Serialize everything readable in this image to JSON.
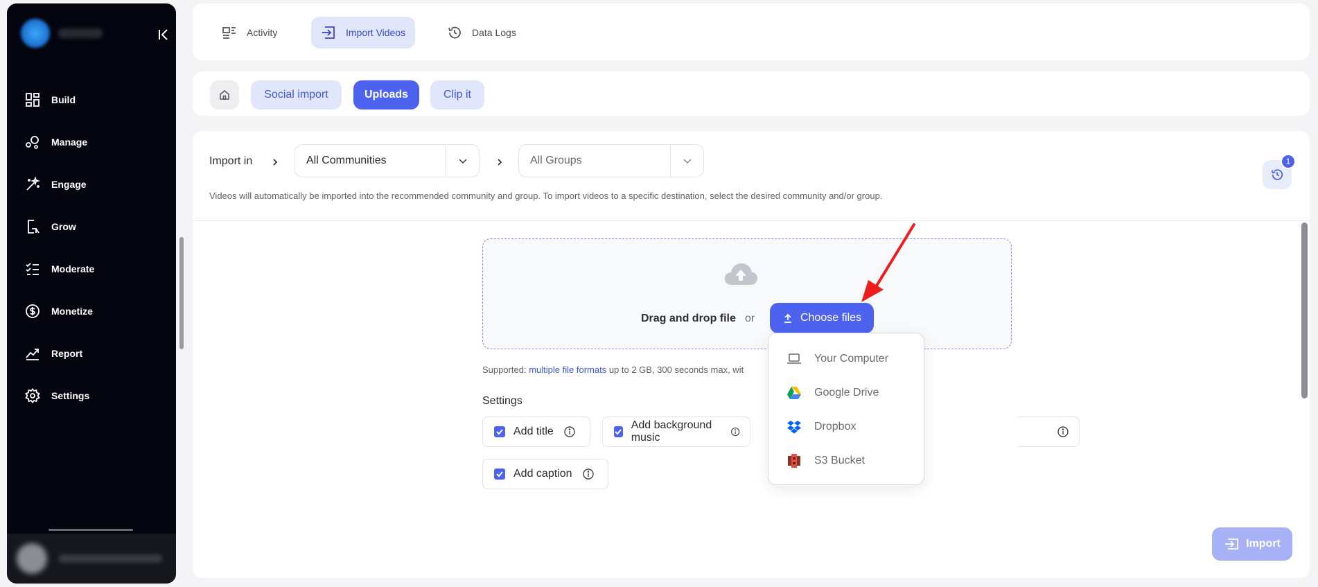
{
  "topTabs": [
    {
      "label": "Activity",
      "icon": "activity-icon",
      "active": false
    },
    {
      "label": "Import Videos",
      "icon": "import-icon",
      "active": true
    },
    {
      "label": "Data Logs",
      "icon": "history-icon",
      "active": false
    }
  ],
  "sidebar": {
    "items": [
      {
        "label": "Build",
        "icon": "grid-icon"
      },
      {
        "label": "Manage",
        "icon": "manage-icon"
      },
      {
        "label": "Engage",
        "icon": "magic-wand-icon"
      },
      {
        "label": "Grow",
        "icon": "phone-arrow-icon"
      },
      {
        "label": "Moderate",
        "icon": "checklist-icon"
      },
      {
        "label": "Monetize",
        "icon": "dollar-icon"
      },
      {
        "label": "Report",
        "icon": "trend-icon"
      },
      {
        "label": "Settings",
        "icon": "gear-icon"
      }
    ]
  },
  "subTabs": {
    "social": "Social import",
    "uploads": "Uploads",
    "clip": "Clip it"
  },
  "importIn": {
    "label": "Import in",
    "community": "All Communities",
    "group": "All Groups",
    "hint": "Videos will automatically be imported into the recommended community and group. To import videos to a specific destination, select the desired community and/or group.",
    "historyBadge": "1"
  },
  "dropzone": {
    "text": "Drag and drop file",
    "or": "or",
    "chooseLabel": "Choose files"
  },
  "supported": {
    "prefix": "Supported: ",
    "link": "multiple file formats",
    "suffix": " up to 2 GB, 300 seconds max, wit"
  },
  "settings": {
    "label": "Settings",
    "options": {
      "title": "Add title",
      "music": "Add background music",
      "caption": "Add caption"
    }
  },
  "menu": {
    "items": [
      "Your Computer",
      "Google Drive",
      "Dropbox",
      "S3 Bucket"
    ]
  },
  "importButton": "Import",
  "colors": {
    "accent": "#4d63ef",
    "sidebar": "#05050f",
    "annotation": "#ee1c1c"
  }
}
